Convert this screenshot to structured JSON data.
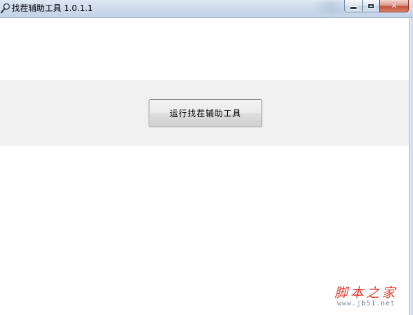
{
  "window": {
    "title": "找茬辅助工具 1.0.1.1",
    "icon": "magnifier-icon"
  },
  "caption_buttons": {
    "minimize_icon": "minimize-icon",
    "maximize_icon": "maximize-icon",
    "close_icon": "close-icon",
    "close_glyph": "✕"
  },
  "main": {
    "run_button_label": "运行找茬辅助工具"
  },
  "watermark": {
    "text": "脚本之家",
    "url": "www.jb51.net"
  },
  "colors": {
    "panel_background": "#f0f0f0",
    "watermark_red": "#e23b2e",
    "close_button_red": "#c3523a"
  }
}
